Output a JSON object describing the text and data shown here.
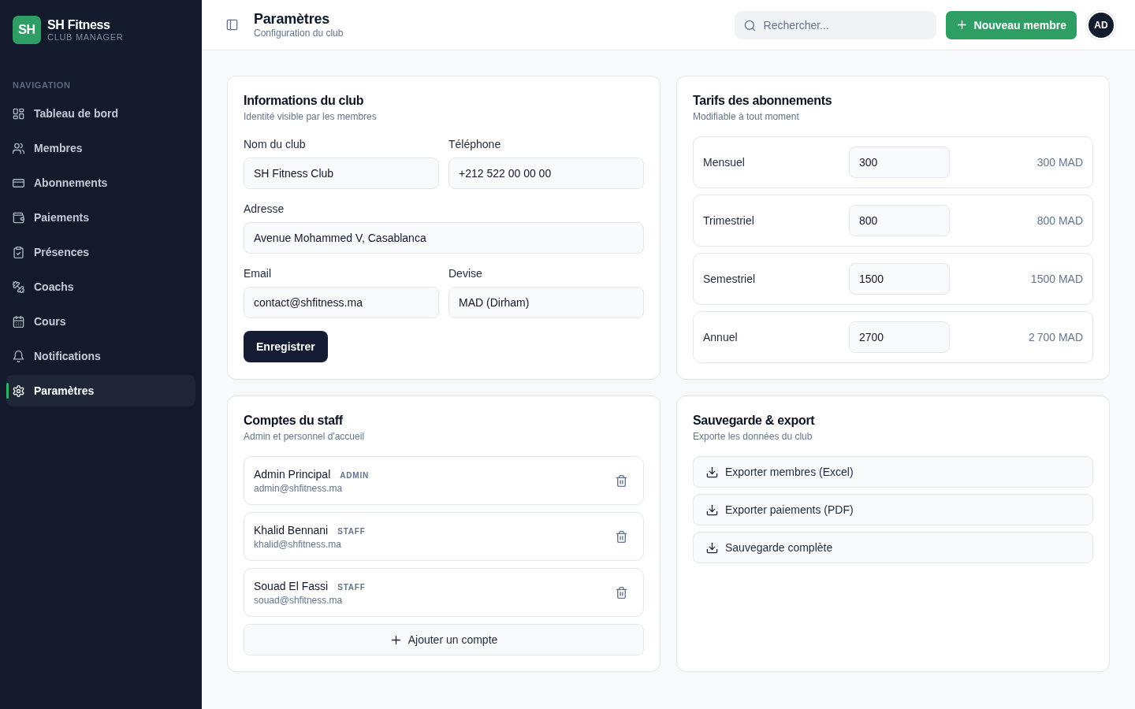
{
  "sidebar": {
    "brand": {
      "initials": "SH",
      "name": "SH Fitness",
      "tagline": "CLUB MANAGER"
    },
    "section_label": "NAVIGATION",
    "items": [
      {
        "label": "Tableau de bord",
        "selected": false
      },
      {
        "label": "Membres",
        "selected": false
      },
      {
        "label": "Abonnements",
        "selected": false
      },
      {
        "label": "Paiements",
        "selected": false
      },
      {
        "label": "Présences",
        "selected": false
      },
      {
        "label": "Coachs",
        "selected": false
      },
      {
        "label": "Cours",
        "selected": false
      },
      {
        "label": "Notifications",
        "selected": false
      },
      {
        "label": "Paramètres",
        "selected": true
      }
    ]
  },
  "header": {
    "title": "Paramètres",
    "subtitle": "Configuration du club",
    "search": {
      "placeholder": "Rechercher..."
    },
    "new_button": "Nouveau membre",
    "avatar": "AD"
  },
  "club_info": {
    "title": "Informations du club",
    "subtitle": "Identité visible par les membres",
    "rows": [
      [
        {
          "label": "Nom du club",
          "value": "SH Fitness Club"
        },
        {
          "label": "Téléphone",
          "value": "+212 522 00 00 00"
        }
      ],
      [
        {
          "label": "Adresse",
          "value": "Avenue Mohammed V, Casablanca"
        }
      ],
      [
        {
          "label": "Email",
          "value": "contact@shfitness.ma"
        },
        {
          "label": "Devise",
          "value": "MAD (Dirham)"
        }
      ]
    ],
    "save_button": "Enregistrer"
  },
  "pricing": {
    "title": "Tarifs des abonnements",
    "subtitle": "Modifiable à tout moment",
    "plans": [
      {
        "name": "Mensuel",
        "value": "300",
        "reading": "300 MAD"
      },
      {
        "name": "Trimestriel",
        "value": "800",
        "reading": "800 MAD"
      },
      {
        "name": "Semestriel",
        "value": "1500",
        "reading": "1500 MAD"
      },
      {
        "name": "Annuel",
        "value": "2700",
        "reading": "2 700 MAD"
      }
    ]
  },
  "staff": {
    "title": "Comptes du staff",
    "subtitle": "Admin et personnel d'accueil",
    "accounts": [
      {
        "name": "Admin Principal",
        "role": "ADMIN",
        "email": "admin@shfitness.ma"
      },
      {
        "name": "Khalid Bennani",
        "role": "STAFF",
        "email": "khalid@shfitness.ma"
      },
      {
        "name": "Souad El Fassi",
        "role": "STAFF",
        "email": "souad@shfitness.ma"
      }
    ],
    "add_button": "Ajouter un compte"
  },
  "backup": {
    "title": "Sauvegarde & export",
    "subtitle": "Exporte les données du club",
    "actions": [
      "Exporter membres (Excel)",
      "Exporter paiements (PDF)",
      "Sauvegarde complète"
    ]
  }
}
